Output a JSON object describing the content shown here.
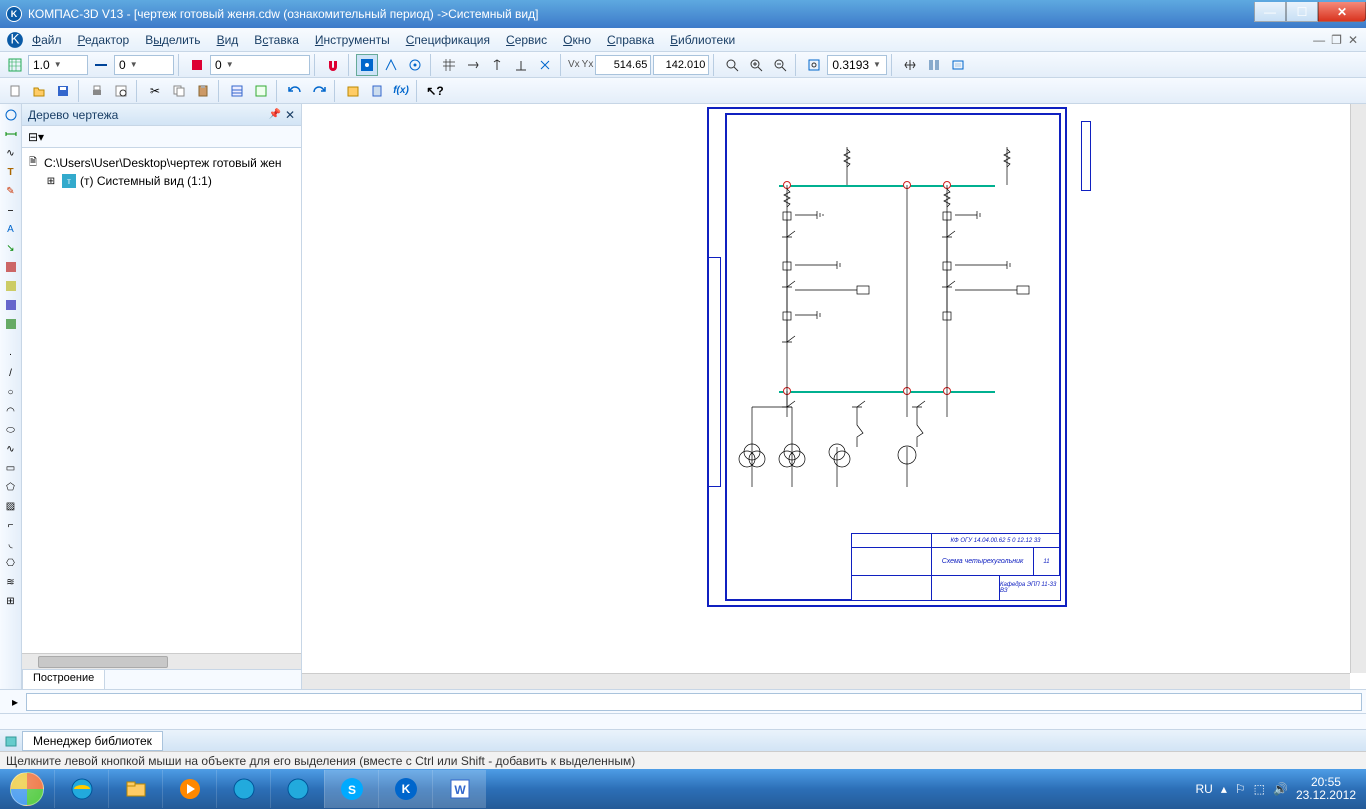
{
  "title": "КОМПАС-3D V13 - [чертеж готовый женя.cdw (ознакомительный период) ->Системный вид]",
  "menu": [
    "Файл",
    "Редактор",
    "Выделить",
    "Вид",
    "Вставка",
    "Инструменты",
    "Спецификация",
    "Сервис",
    "Окно",
    "Справка",
    "Библиотеки"
  ],
  "menu_underline": [
    0,
    0,
    1,
    0,
    1,
    0,
    0,
    0,
    0,
    0,
    0
  ],
  "tb1": {
    "step": "1.0",
    "style": "0",
    "layer": "0"
  },
  "tb2": {
    "coord_x": "514.65",
    "coord_y": "142.010",
    "zoom": "0.3193",
    "x_lbl": "Vx",
    "y_lbl": "Yx"
  },
  "tree": {
    "title": "Дерево чертежа",
    "file": "C:\\Users\\User\\Desktop\\чертеж готовый жен",
    "view": "(т) Системный вид (1:1)"
  },
  "tab": "Построение",
  "libmgr": "Менеджер библиотек",
  "status": "Щелкните левой кнопкой мыши на объекте для его выделения (вместе с Ctrl или Shift - добавить к выделенным)",
  "tray": {
    "lang": "RU",
    "time": "20:55",
    "date": "23.12.2012"
  },
  "titleblock": {
    "code": "КФ ОГУ 14.04.00.62  5 0 12.12 33",
    "name": "Схема четырехугольник",
    "sheet": "11",
    "dept": "Кафедра ЭПП 11-33 ВЗ"
  }
}
